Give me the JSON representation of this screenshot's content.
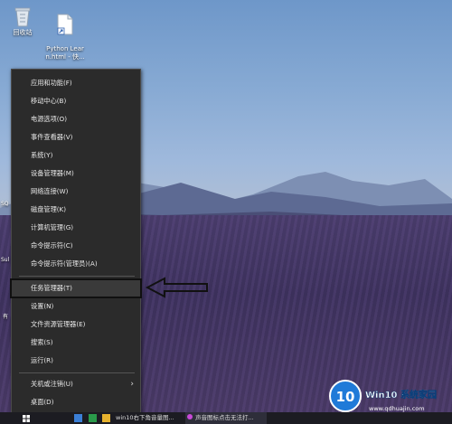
{
  "desktop": {
    "icons": [
      {
        "label": "回收站",
        "icon": "recycle-bin-icon"
      },
      {
        "label": "Python Lear\nn.html - 快...",
        "icon": "html-file-shortcut-icon"
      }
    ],
    "peek_labels": [
      "SQ",
      "Sul",
      "有"
    ]
  },
  "menu": {
    "items": [
      {
        "label": "应用和功能(F)"
      },
      {
        "label": "移动中心(B)"
      },
      {
        "label": "电源选项(O)"
      },
      {
        "label": "事件查看器(V)"
      },
      {
        "label": "系统(Y)"
      },
      {
        "label": "设备管理器(M)"
      },
      {
        "label": "网络连接(W)"
      },
      {
        "label": "磁盘管理(K)"
      },
      {
        "label": "计算机管理(G)"
      },
      {
        "label": "命令提示符(C)"
      },
      {
        "label": "命令提示符(管理员)(A)"
      },
      {
        "label": "任务管理器(T)",
        "highlighted": true
      },
      {
        "label": "设置(N)"
      },
      {
        "label": "文件资源管理器(E)"
      },
      {
        "label": "搜索(S)"
      },
      {
        "label": "运行(R)"
      },
      {
        "label": "关机或注销(U)",
        "submenu_glyph": "›"
      },
      {
        "label": "桌面(D)"
      }
    ]
  },
  "taskbar": {
    "items": [
      {
        "label": "win10右下角音量图..."
      },
      {
        "label": "声音图标点击无法打..."
      }
    ]
  },
  "watermark": {
    "logo": "10",
    "brand": "Win10 系统家园",
    "url": "www.qdhuajin.com"
  }
}
